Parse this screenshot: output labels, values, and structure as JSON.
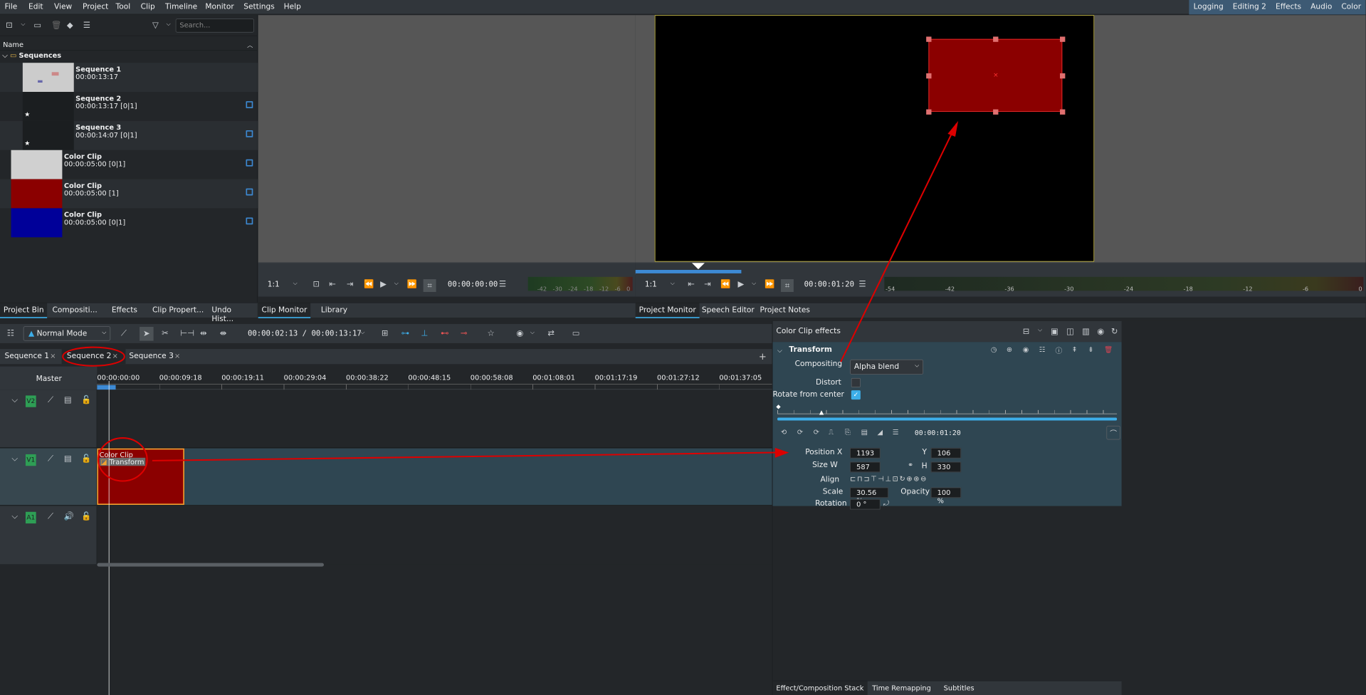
{
  "menubar": {
    "items": [
      "File",
      "Edit",
      "View",
      "Project",
      "Tool",
      "Clip",
      "Timeline",
      "Monitor",
      "Settings",
      "Help"
    ],
    "workspaces": [
      "Logging",
      "Editing 2",
      "Effects",
      "Audio",
      "Color"
    ]
  },
  "bin": {
    "search_placeholder": "Search...",
    "header": "Name",
    "folder": "Sequences",
    "items": [
      {
        "name": "Sequence 1",
        "dur": "00:00:13:17"
      },
      {
        "name": "Sequence 2",
        "dur": "00:00:13:17 [0|1]"
      },
      {
        "name": "Sequence 3",
        "dur": "00:00:14:07 [0|1]"
      },
      {
        "name": "Color Clip",
        "dur": "00:00:05:00 [0|1]",
        "color": "#d0d0d0"
      },
      {
        "name": "Color Clip",
        "dur": "00:00:05:00 [1]",
        "color": "#8b0000"
      },
      {
        "name": "Color Clip",
        "dur": "00:00:05:00 [0|1]",
        "color": "#000099"
      }
    ]
  },
  "clip_monitor": {
    "zoom": "1:1",
    "timecode": "00:00:00:00",
    "meter": [
      "-42",
      "-30",
      "-24",
      "-18",
      "-12",
      "-6",
      "0"
    ]
  },
  "project_monitor": {
    "zoom": "1:1",
    "timecode": "00:00:01:20",
    "meter": [
      "-54",
      "-42",
      "-36",
      "-30",
      "-24",
      "-18",
      "-12",
      "-6",
      "0"
    ]
  },
  "dock_tabs_left": [
    "Project Bin",
    "Compositi...",
    "Effects",
    "Clip Propert...",
    "Undo Hist..."
  ],
  "dock_tabs_mid": [
    "Clip Monitor",
    "Library"
  ],
  "dock_tabs_right": [
    "Project Monitor",
    "Speech Editor",
    "Project Notes"
  ],
  "timeline": {
    "mode": "Normal Mode",
    "timecode": "00:00:02:13 / 00:00:13:17",
    "seq_tabs": [
      "Sequence 1",
      "Sequence 2",
      "Sequence 3"
    ],
    "master": "Master",
    "ruler": [
      "00:00:00:00",
      "00:00:09:18",
      "00:00:19:11",
      "00:00:29:04",
      "00:00:38:22",
      "00:00:48:15",
      "00:00:58:08",
      "00:01:08:01",
      "00:01:17:19",
      "00:01:27:12",
      "00:01:37:05"
    ],
    "tracks": [
      "V2",
      "V1",
      "A1"
    ],
    "clip": {
      "name": "Color Clip",
      "effect": "Transform"
    }
  },
  "effects": {
    "title": "Color Clip effects",
    "effect": "Transform",
    "compositing_label": "Compositing",
    "compositing": "Alpha blend",
    "distort": "Distort",
    "rotate": "Rotate from center",
    "timecode": "00:00:01:20",
    "pos_x_label": "Position X",
    "pos_x": "1193",
    "y_label": "Y",
    "pos_y": "106",
    "size_label": "Size W",
    "size_w": "587",
    "h_label": "H",
    "size_h": "330",
    "align": "Align",
    "scale_label": "Scale",
    "scale": "30.56 %",
    "opacity_label": "Opacity",
    "opacity": "100 %",
    "rotation_label": "Rotation",
    "rotation": "0 °",
    "tabs": [
      "Effect/Composition Stack",
      "Time Remapping",
      "Subtitles"
    ]
  }
}
